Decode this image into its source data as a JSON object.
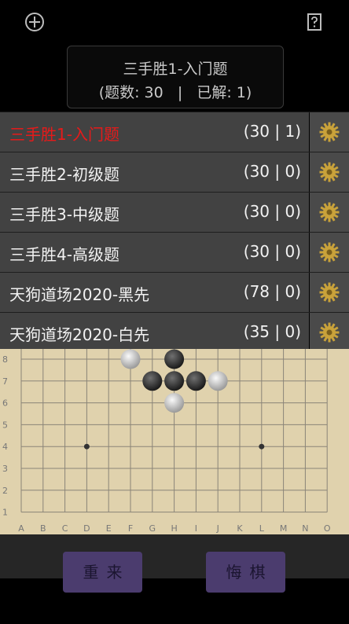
{
  "header": {
    "title": "三手胜1-入门题",
    "stats": "(题数: 30   |   已解: 1)"
  },
  "menu": {
    "items": [
      {
        "label": "三手胜1-入门题",
        "count": "(30 | 1)",
        "active": true
      },
      {
        "label": "三手胜2-初级题",
        "count": "(30 | 0)",
        "active": false
      },
      {
        "label": "三手胜3-中级题",
        "count": "(30 | 0)",
        "active": false
      },
      {
        "label": "三手胜4-高级题",
        "count": "(30 | 0)",
        "active": false
      },
      {
        "label": "天狗道场2020-黑先",
        "count": "(78 | 0)",
        "active": false
      },
      {
        "label": "天狗道场2020-白先",
        "count": "(35 | 0)",
        "active": false
      }
    ]
  },
  "board": {
    "files": [
      "A",
      "B",
      "C",
      "D",
      "E",
      "F",
      "G",
      "H",
      "I",
      "J",
      "K",
      "L",
      "M",
      "N",
      "O"
    ],
    "ranks": [
      "8",
      "7",
      "6",
      "5",
      "4",
      "3",
      "2",
      "1"
    ],
    "star_points": [
      [
        "D",
        "4"
      ],
      [
        "L",
        "4"
      ]
    ],
    "stones": [
      {
        "color": "white",
        "file": "F",
        "rank": "8"
      },
      {
        "color": "black",
        "file": "H",
        "rank": "8"
      },
      {
        "color": "black",
        "file": "G",
        "rank": "7"
      },
      {
        "color": "black",
        "file": "H",
        "rank": "7"
      },
      {
        "color": "black",
        "file": "I",
        "rank": "7"
      },
      {
        "color": "white",
        "file": "J",
        "rank": "7"
      },
      {
        "color": "white",
        "file": "H",
        "rank": "6"
      }
    ]
  },
  "actions": {
    "restart_label": "重来",
    "undo_label": "悔棋"
  },
  "colors": {
    "active_item": "#e61a1a",
    "board": "#e0d2ad",
    "button": "#4b3c6e",
    "gear": "#c9a23a"
  }
}
